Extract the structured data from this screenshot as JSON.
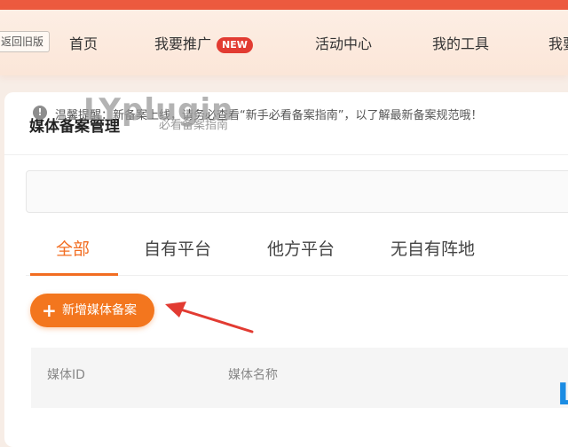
{
  "topnav": {
    "old_version": "返回旧版",
    "items": [
      {
        "label": "首页"
      },
      {
        "label": "我要推广",
        "badge": "NEW"
      },
      {
        "label": "活动中心"
      },
      {
        "label": "我的工具"
      },
      {
        "label": "我要"
      }
    ]
  },
  "page": {
    "title": "媒体备案管理",
    "guide_link": "必看备案指南"
  },
  "notice": {
    "icon": "info-icon",
    "text": "温馨提醒：新备案上线，请务必查看“新手必看备案指南”，以了解最新备案规范哦！"
  },
  "tabs": [
    {
      "label": "全部",
      "active": true
    },
    {
      "label": "自有平台",
      "active": false
    },
    {
      "label": "他方平台",
      "active": false
    },
    {
      "label": "无自有阵地",
      "active": false
    }
  ],
  "add_button": {
    "icon": "plus-icon",
    "label": "新增媒体备案"
  },
  "table": {
    "columns": [
      "媒体ID",
      "媒体名称"
    ]
  },
  "watermark": "LYplugin",
  "colors": {
    "accent": "#f3761e",
    "top_strip": "#ec5a3f",
    "badge": "#e23b32"
  }
}
